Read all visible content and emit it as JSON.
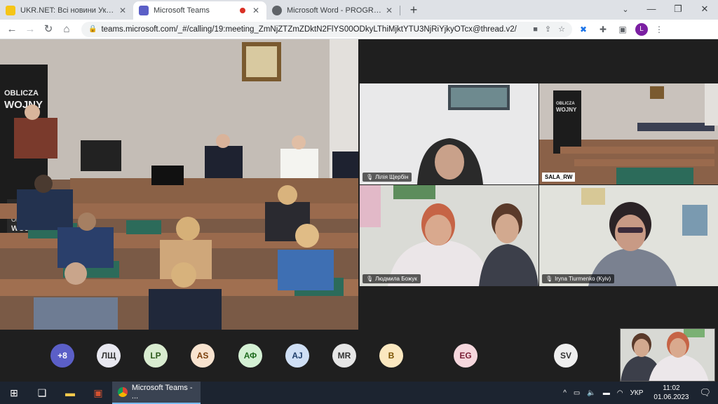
{
  "browser": {
    "tabs": [
      {
        "title": "UKR.NET: Всі новини України, ос",
        "favicon_color": "#f5c518"
      },
      {
        "title": "Microsoft Teams",
        "favicon_color": "#5b5fc7"
      },
      {
        "title": "Microsoft Word - PROGRAM OW",
        "favicon_color": "#5f6368"
      }
    ],
    "new_tab": "+",
    "window_controls": {
      "minimize": "—",
      "maximize": "❐",
      "close": "✕"
    },
    "url": "teams.microsoft.com/_#/calling/19:meeting_ZmNjZTZmZDktN2FlYS00ODkyLThiMjktYTU3NjRiYjkyOTcx@thread.v2/",
    "profile_initial": "L"
  },
  "meeting": {
    "participants": [
      {
        "name": "Лілія Щербін"
      },
      {
        "name": "SALA_RW"
      },
      {
        "name": "Людмила Божук"
      },
      {
        "name": "Iryna Tiurmenko (Kyiv)"
      }
    ],
    "room_banner": {
      "line1": "OBLICZA",
      "line2": "WOJNY"
    },
    "avatars": [
      {
        "initials": "+8",
        "bg": "#5b5fc7",
        "fg": "#ffffff"
      },
      {
        "initials": "ЛЩ",
        "bg": "#e8e8f0",
        "fg": "#333333"
      },
      {
        "initials": "LP",
        "bg": "#d9ecd0",
        "fg": "#2d5a1b"
      },
      {
        "initials": "AS",
        "bg": "#f8e3cf",
        "fg": "#7a3e0a"
      },
      {
        "initials": "АФ",
        "bg": "#d4f0d4",
        "fg": "#1e6b1e"
      },
      {
        "initials": "AJ",
        "bg": "#cfdff5",
        "fg": "#1f3e6b"
      },
      {
        "initials": "MR",
        "bg": "#e6e6e6",
        "fg": "#333333"
      },
      {
        "initials": "B",
        "bg": "#fbe8c0",
        "fg": "#7a5200"
      },
      {
        "initials": "EG",
        "bg": "#f5d7dd",
        "fg": "#7a1f35"
      },
      {
        "initials": "SV",
        "bg": "#eeeeee",
        "fg": "#333333"
      }
    ]
  },
  "taskbar": {
    "teams_label": "Microsoft Teams - ...",
    "language": "УКР",
    "time": "11:02",
    "date": "01.06.2023"
  }
}
